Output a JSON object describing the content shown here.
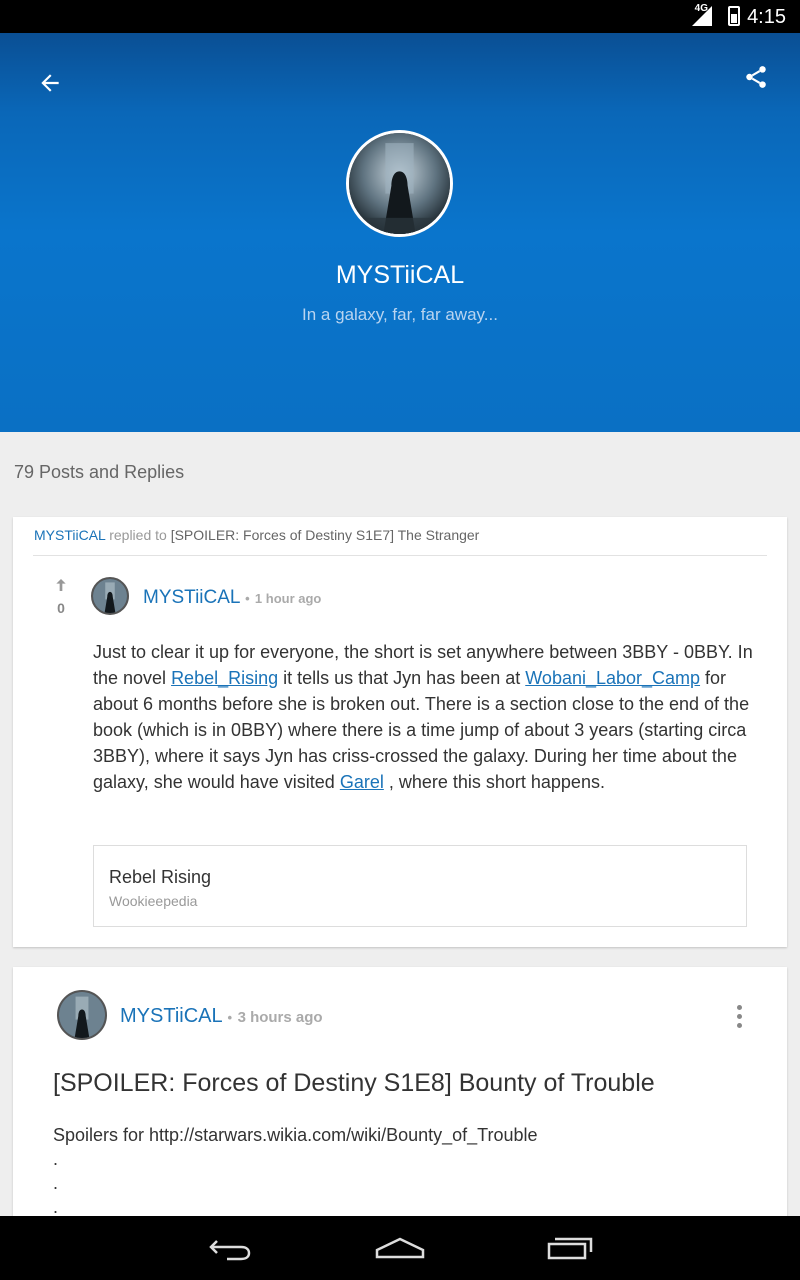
{
  "status_bar": {
    "network": "4G",
    "time": "4:15"
  },
  "profile": {
    "name": "MYSTiiCAL",
    "tagline": "In a galaxy, far, far away..."
  },
  "posts_count": "79 Posts and Replies",
  "reply_card": {
    "username": "MYSTiiCAL",
    "replied_to_text": "replied to",
    "thread_title": "[SPOILER: Forces of Destiny S1E7] The Stranger",
    "vote_count": "0",
    "author": "MYSTiiCAL",
    "separator": "•",
    "time_ago": "1 hour ago",
    "body": {
      "part1": "Just to clear it up for everyone, the short is set anywhere between 3BBY - 0BBY. In the novel ",
      "link1": "Rebel_Rising",
      "part2": " it tells us that Jyn has been at ",
      "link2": "Wobani_Labor_Camp",
      "part3": " for about 6 months before she is broken out. There is a section close to the end of the book (which is in 0BBY) where there is a time jump of about 3 years (starting circa 3BBY), where it says Jyn has criss-crossed the galaxy. During her time about the galaxy, she would have visited ",
      "link3": "Garel",
      "part4": " , where this short happens."
    },
    "link_preview": {
      "title": "Rebel Rising",
      "source": "Wookieepedia"
    }
  },
  "post_card": {
    "author": "MYSTiiCAL",
    "separator": "•",
    "time_ago": "3 hours ago",
    "title": "[SPOILER: Forces of Destiny S1E8] Bounty of Trouble",
    "body_line1": "Spoilers for  http://starwars.wikia.com/wiki/Bounty_of_Trouble",
    "body_dots": [
      ".",
      ".",
      "."
    ]
  },
  "colors": {
    "header_blue": "#0a70c4",
    "link_blue": "#1a73b8"
  }
}
